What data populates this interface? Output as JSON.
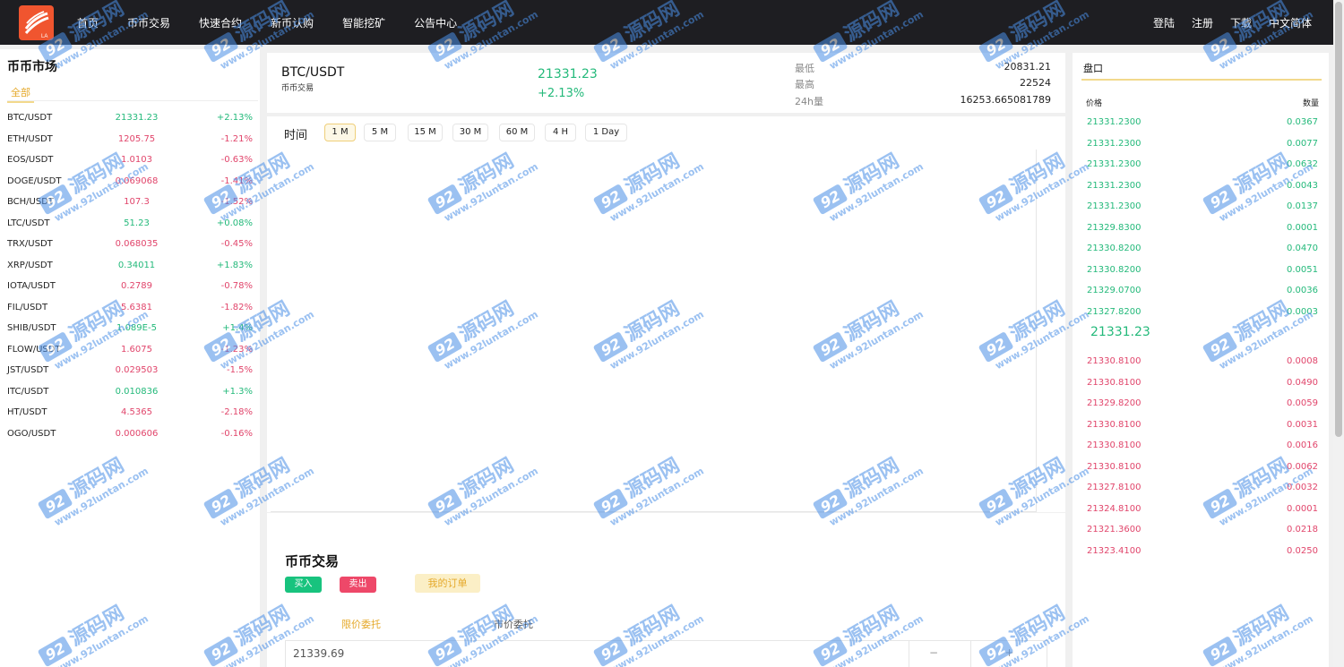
{
  "nav": {
    "left": [
      "首页",
      "币币交易",
      "快速合约",
      "新币认购",
      "智能挖矿",
      "公告中心"
    ],
    "right": [
      "登陆",
      "注册",
      "下载",
      "中文简体"
    ]
  },
  "market": {
    "title": "币币市场",
    "tab": "全部",
    "rows": [
      {
        "symbol": "BTC/USDT",
        "price": "21331.23",
        "change": "+2.13%",
        "dir": "up"
      },
      {
        "symbol": "ETH/USDT",
        "price": "1205.75",
        "change": "-1.21%",
        "dir": "down"
      },
      {
        "symbol": "EOS/USDT",
        "price": "1.0103",
        "change": "-0.63%",
        "dir": "down"
      },
      {
        "symbol": "DOGE/USDT",
        "price": "0.069068",
        "change": "-1.41%",
        "dir": "down"
      },
      {
        "symbol": "BCH/USDT",
        "price": "107.3",
        "change": "-1.52%",
        "dir": "down"
      },
      {
        "symbol": "LTC/USDT",
        "price": "51.23",
        "change": "+0.08%",
        "dir": "up"
      },
      {
        "symbol": "TRX/USDT",
        "price": "0.068035",
        "change": "-0.45%",
        "dir": "down"
      },
      {
        "symbol": "XRP/USDT",
        "price": "0.34011",
        "change": "+1.83%",
        "dir": "up"
      },
      {
        "symbol": "IOTA/USDT",
        "price": "0.2789",
        "change": "-0.78%",
        "dir": "down"
      },
      {
        "symbol": "FIL/USDT",
        "price": "5.6381",
        "change": "-1.82%",
        "dir": "down"
      },
      {
        "symbol": "SHIB/USDT",
        "price": "1.089E-5",
        "change": "+1.4%",
        "dir": "up"
      },
      {
        "symbol": "FLOW/USDT",
        "price": "1.6075",
        "change": "-1.23%",
        "dir": "down"
      },
      {
        "symbol": "JST/USDT",
        "price": "0.029503",
        "change": "-1.5%",
        "dir": "down"
      },
      {
        "symbol": "ITC/USDT",
        "price": "0.010836",
        "change": "+1.3%",
        "dir": "up"
      },
      {
        "symbol": "HT/USDT",
        "price": "4.5365",
        "change": "-2.18%",
        "dir": "down"
      },
      {
        "symbol": "OGO/USDT",
        "price": "0.000606",
        "change": "-0.16%",
        "dir": "down"
      }
    ]
  },
  "ticker": {
    "pair": "BTC/USDT",
    "sub": "币币交易",
    "last": "21331.23",
    "change": "+2.13%",
    "low_label": "最低",
    "low": "20831.21",
    "high_label": "最高",
    "high": "22524",
    "vol_label": "24h量",
    "vol": "16253.665081789"
  },
  "chart": {
    "time_label": "时间",
    "timeframes": [
      "1 M",
      "5 M",
      "15 M",
      "30 M",
      "60 M",
      "4 H",
      "1 Day"
    ],
    "active": "1 M"
  },
  "trade": {
    "title": "币币交易",
    "buy": "买入",
    "sell": "卖出",
    "orders": "我的订单",
    "tab_limit": "限价委托",
    "tab_market": "市价委托",
    "price_value": "21339.69",
    "minus": "−",
    "plus": "+"
  },
  "book": {
    "title": "盘口",
    "col_price": "价格",
    "col_qty": "数量",
    "asks": [
      {
        "p": "21331.2300",
        "q": "0.0367"
      },
      {
        "p": "21331.2300",
        "q": "0.0077"
      },
      {
        "p": "21331.2300",
        "q": "0.0632"
      },
      {
        "p": "21331.2300",
        "q": "0.0043"
      },
      {
        "p": "21331.2300",
        "q": "0.0137"
      },
      {
        "p": "21329.8300",
        "q": "0.0001"
      },
      {
        "p": "21330.8200",
        "q": "0.0470"
      },
      {
        "p": "21330.8200",
        "q": "0.0051"
      },
      {
        "p": "21329.0700",
        "q": "0.0036"
      },
      {
        "p": "21327.8200",
        "q": "0.0003"
      }
    ],
    "mid": "21331.23",
    "bids": [
      {
        "p": "21330.8100",
        "q": "0.0008"
      },
      {
        "p": "21330.8100",
        "q": "0.0490"
      },
      {
        "p": "21329.8200",
        "q": "0.0059"
      },
      {
        "p": "21330.8100",
        "q": "0.0031"
      },
      {
        "p": "21330.8100",
        "q": "0.0016"
      },
      {
        "p": "21330.8100",
        "q": "0.0062"
      },
      {
        "p": "21327.8100",
        "q": "0.0032"
      },
      {
        "p": "21324.8100",
        "q": "0.0001"
      },
      {
        "p": "21321.3600",
        "q": "0.0218"
      },
      {
        "p": "21323.4100",
        "q": "0.0250"
      }
    ]
  },
  "watermark": {
    "tag": "92",
    "cn": "源码网",
    "url": "www.92luntan.com"
  },
  "colors": {
    "up": "#23b97a",
    "down": "#e1456b",
    "accent": "#e5a92b",
    "nav_bg": "#1e1e22"
  }
}
